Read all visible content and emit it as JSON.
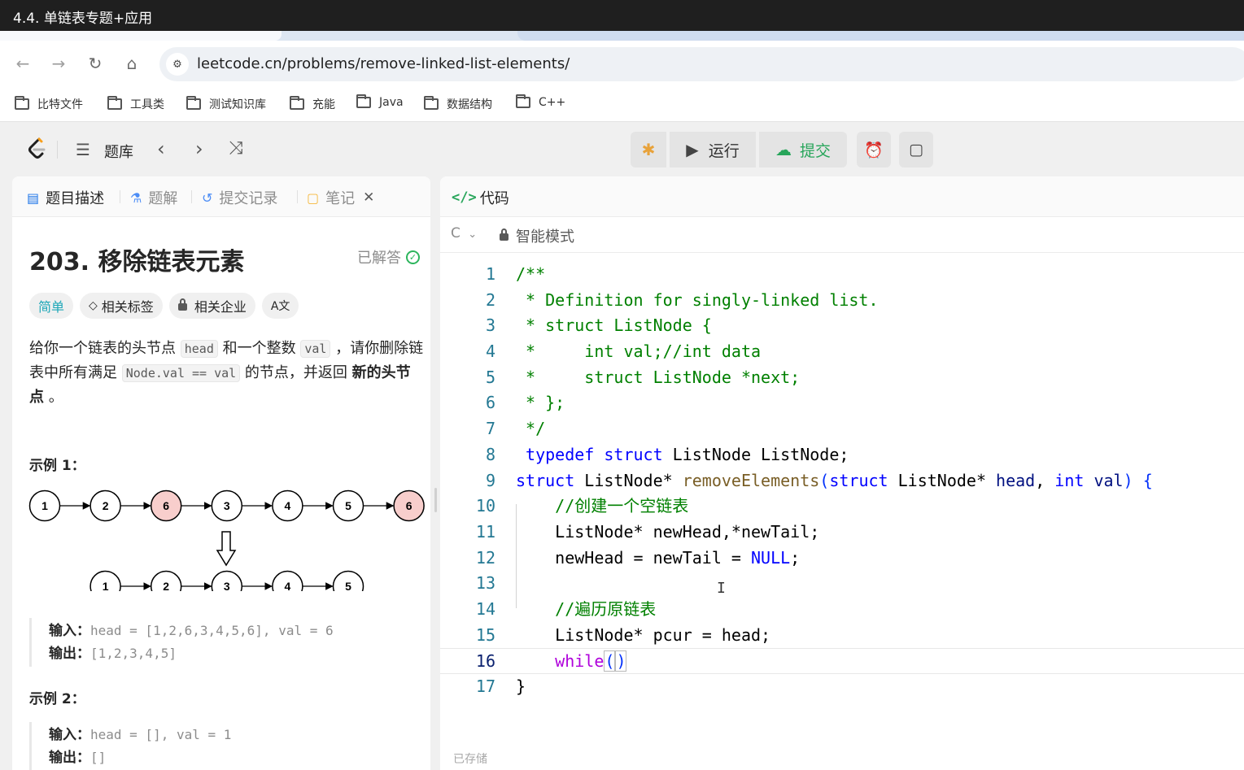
{
  "window": {
    "title": "4.4. 单链表专题+应用"
  },
  "browser": {
    "url": "leetcode.cn/problems/remove-linked-list-elements/",
    "bookmarks": [
      "比特文件",
      "工具类",
      "测试知识库",
      "充能",
      "Java",
      "数据结构",
      "C++"
    ]
  },
  "toolbar": {
    "problem_list": "题库",
    "run_label": "运行",
    "submit_label": "提交"
  },
  "left_tabs": {
    "description": "题目描述",
    "solutions": "题解",
    "submissions": "提交记录",
    "notes": "笔记"
  },
  "problem": {
    "title": "203. 移除链表元素",
    "status": "已解答",
    "difficulty": "简单",
    "tag_topics": "相关标签",
    "tag_companies": "相关企业",
    "tag_translate": "A文",
    "desc_part1": "给你一个链表的头节点 ",
    "desc_code1": "head",
    "desc_part2": " 和一个整数 ",
    "desc_code2": "val",
    "desc_part3": " ，请你删除链表中所有满足 ",
    "desc_code3": "Node.val == val",
    "desc_part4": " 的节点，并返回 ",
    "desc_bold": "新的头节点",
    "desc_part5": " 。",
    "example1_title": "示例 1：",
    "example1_diagram": {
      "top": [
        "1",
        "2",
        "6",
        "3",
        "4",
        "5",
        "6"
      ],
      "highlight_color": "#f8cecc",
      "bottom": [
        "1",
        "2",
        "3",
        "4",
        "5"
      ]
    },
    "example1_input_label": "输入：",
    "example1_input": "head = [1,2,6,3,4,5,6], val = 6",
    "example1_output_label": "输出：",
    "example1_output": "[1,2,3,4,5]",
    "example2_title": "示例 2：",
    "example2_input_label": "输入：",
    "example2_input": "head = [], val = 1",
    "example2_output_label": "输出：",
    "example2_output": "[]"
  },
  "editor": {
    "tab_label": "代码",
    "language": "C",
    "mode": "智能模式",
    "current_line": 16,
    "footer_status": "已存储",
    "lines": [
      "/**",
      " * Definition for singly-linked list.",
      " * struct ListNode {",
      " *     int val;//int data",
      " *     struct ListNode *next;",
      " * };",
      " */",
      " typedef struct ListNode ListNode;",
      "struct ListNode* removeElements(struct ListNode* head, int val) {",
      "    //创建一个空链表",
      "    ListNode* newHead,*newTail;",
      "    newHead = newTail = NULL;",
      "",
      "    //遍历原链表",
      "    ListNode* pcur = head;",
      "    while()",
      "}"
    ]
  }
}
